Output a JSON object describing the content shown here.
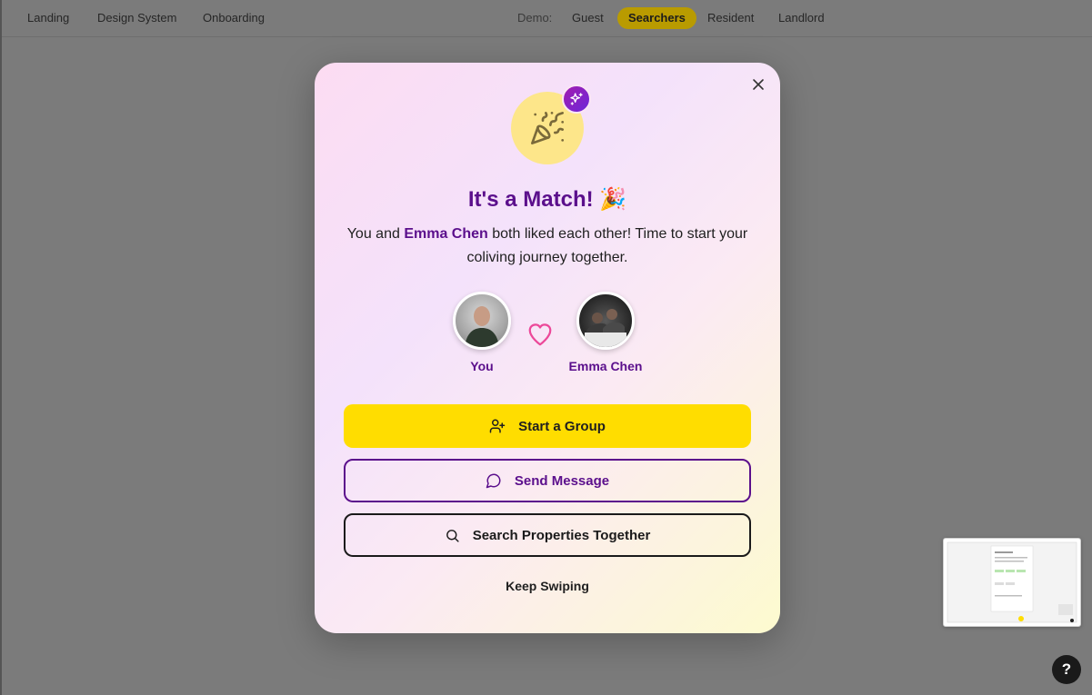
{
  "nav": {
    "links": [
      "Landing",
      "Design System",
      "Onboarding"
    ],
    "demo_label": "Demo:",
    "demo_options": [
      "Guest",
      "Searchers",
      "Resident",
      "Landlord"
    ],
    "demo_selected": "Searchers"
  },
  "modal": {
    "title": "It's a Match! 🎉",
    "subtitle_pre": "You and ",
    "match_name": "Emma Chen",
    "subtitle_post": " both liked each other! Time to start your coliving journey together.",
    "you_label": "You",
    "match_label": "Emma Chen",
    "buttons": {
      "start_group": "Start a Group",
      "send_message": "Send Message",
      "search_together": "Search Properties Together",
      "keep_swiping": "Keep Swiping"
    }
  },
  "help": {
    "label": "?"
  },
  "icons": {
    "close": "close-icon",
    "party": "party-popper-icon",
    "sparkles": "sparkles-icon",
    "heart": "heart-icon",
    "add_user": "user-plus-icon",
    "message": "message-circle-icon",
    "search": "search-icon"
  },
  "colors": {
    "brand_purple": "#5b0f8c",
    "brand_yellow": "#ffdd00",
    "heart_pink": "#ec4899"
  }
}
